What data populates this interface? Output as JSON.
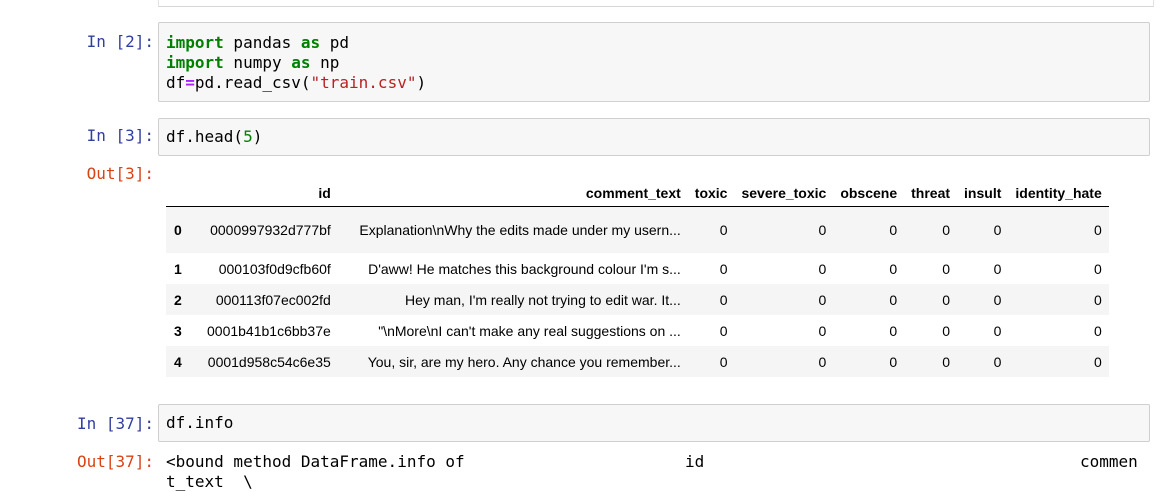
{
  "cells": [
    {
      "prompt": "In [2]:",
      "lines": [
        {
          "kw1": "import",
          "mid": " pandas ",
          "kw2": "as",
          "end": " pd"
        },
        {
          "kw1": "import",
          "mid": " numpy ",
          "kw2": "as",
          "end": " np"
        },
        {
          "pre": "df",
          "op": "=",
          "call": "pd.read_csv(",
          "str": "\"train.csv\"",
          "close": ")"
        }
      ]
    },
    {
      "prompt": "In [3]:",
      "code_pre": "df.head(",
      "code_num": "5",
      "code_post": ")"
    },
    {
      "prompt": "In [37]:",
      "code": "df.info"
    }
  ],
  "outputs": [
    {
      "prompt": "Out[3]:"
    },
    {
      "prompt": "Out[37]:",
      "line1_a": "<bound method DataFrame.info of",
      "line1_b": "id",
      "line1_c": "commen",
      "line2": "t_text  \\"
    }
  ],
  "dataframe": {
    "columns": [
      "",
      "id",
      "comment_text",
      "toxic",
      "severe_toxic",
      "obscene",
      "threat",
      "insult",
      "identity_hate"
    ],
    "rows": [
      {
        "index": "0",
        "id": "0000997932d777bf",
        "comment_text": "Explanation\\nWhy the edits made under my usern...",
        "toxic": "0",
        "severe_toxic": "0",
        "obscene": "0",
        "threat": "0",
        "insult": "0",
        "identity_hate": "0"
      },
      {
        "index": "1",
        "id": "000103f0d9cfb60f",
        "comment_text": "D'aww! He matches this background colour I'm s...",
        "toxic": "0",
        "severe_toxic": "0",
        "obscene": "0",
        "threat": "0",
        "insult": "0",
        "identity_hate": "0"
      },
      {
        "index": "2",
        "id": "000113f07ec002fd",
        "comment_text": "Hey man, I'm really not trying to edit war. It...",
        "toxic": "0",
        "severe_toxic": "0",
        "obscene": "0",
        "threat": "0",
        "insult": "0",
        "identity_hate": "0"
      },
      {
        "index": "3",
        "id": "0001b41b1c6bb37e",
        "comment_text": "\"\\nMore\\nI can't make any real suggestions on ...",
        "toxic": "0",
        "severe_toxic": "0",
        "obscene": "0",
        "threat": "0",
        "insult": "0",
        "identity_hate": "0"
      },
      {
        "index": "4",
        "id": "0001d958c54c6e35",
        "comment_text": "You, sir, are my hero. Any chance you remember...",
        "toxic": "0",
        "severe_toxic": "0",
        "obscene": "0",
        "threat": "0",
        "insult": "0",
        "identity_hate": "0"
      }
    ]
  }
}
